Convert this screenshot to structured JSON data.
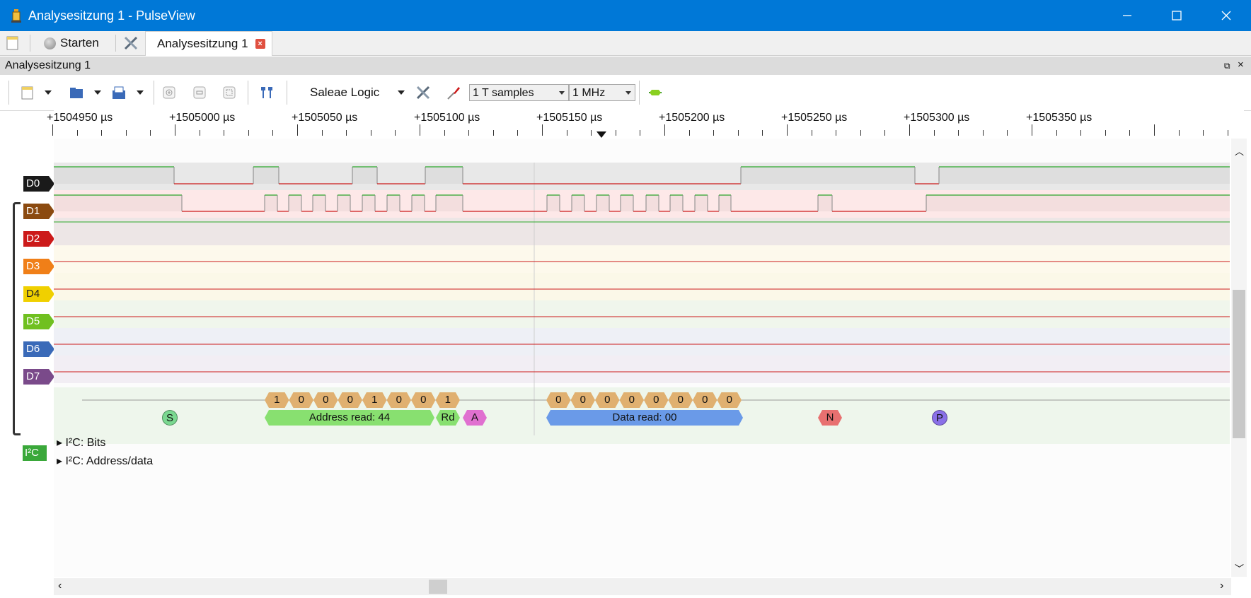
{
  "window": {
    "title": "Analysesitzung 1 - PulseView",
    "minimize_icon": "minimize-icon",
    "maximize_icon": "maximize-icon",
    "close_icon": "close-icon"
  },
  "tabbar": {
    "start_label": "Starten",
    "session_tab": "Analysesitzung 1"
  },
  "dock": {
    "title": "Analysesitzung 1"
  },
  "toolbar": {
    "device": "Saleae Logic",
    "samples": "1 T samples",
    "samplerate": "1 MHz"
  },
  "ruler": {
    "labels": [
      "+1504950 µs",
      "+1505000 µs",
      "+1505050 µs",
      "+1505100 µs",
      "+1505150 µs",
      "+1505200 µs",
      "+1505250 µs",
      "+1505300 µs",
      "+1505350 µs"
    ]
  },
  "channels": [
    {
      "name": "D0",
      "color": "#1a1a1a"
    },
    {
      "name": "D1",
      "color": "#8b4a10"
    },
    {
      "name": "D2",
      "color": "#cc1a1a"
    },
    {
      "name": "D3",
      "color": "#f07f18"
    },
    {
      "name": "D4",
      "color": "#f0d000"
    },
    {
      "name": "D5",
      "color": "#70c020"
    },
    {
      "name": "D6",
      "color": "#3a6ab8"
    },
    {
      "name": "D7",
      "color": "#7a4a8a"
    }
  ],
  "decoder": {
    "label": "I²C",
    "row_bits": "I²C: Bits",
    "row_addr": "I²C: Address/data",
    "bits_addr": [
      "1",
      "0",
      "0",
      "0",
      "1",
      "0",
      "0",
      "1"
    ],
    "bits_data": [
      "0",
      "0",
      "0",
      "0",
      "0",
      "0",
      "0",
      "0"
    ],
    "start": "S",
    "address_read": "Address read: 44",
    "rw": "Rd",
    "ack": "A",
    "data_read": "Data read: 00",
    "nack": "N",
    "stop": "P"
  }
}
